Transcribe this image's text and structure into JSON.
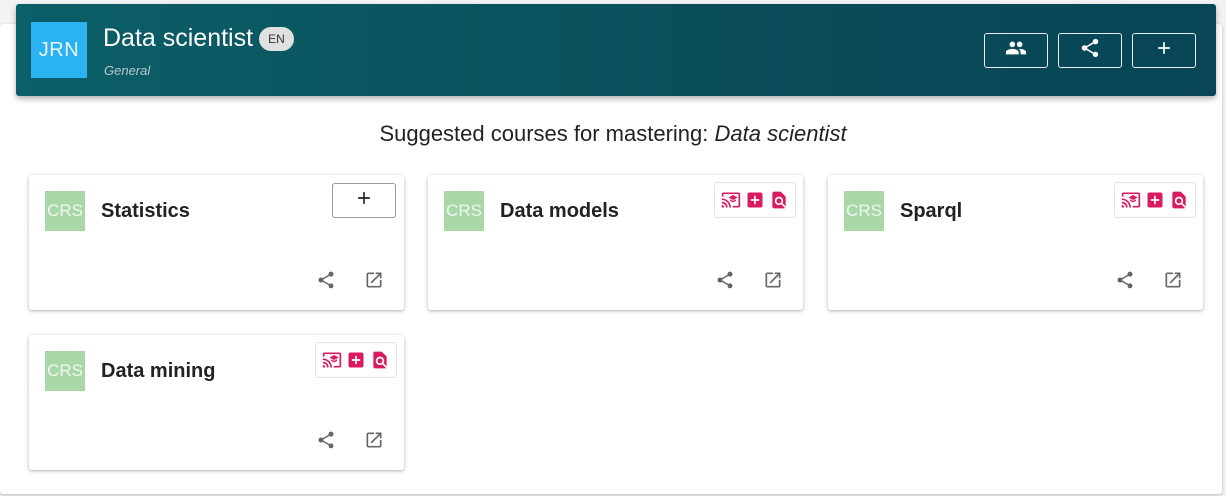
{
  "header": {
    "avatar_text": "JRN",
    "title": "Data scientist",
    "lang": "EN",
    "subtitle": "General",
    "buttons": [
      "group-icon",
      "share-icon",
      "plus-icon"
    ]
  },
  "section": {
    "prefix": "Suggested courses for mastering: ",
    "subject": "Data scientist"
  },
  "cards": [
    {
      "avatar": "CRS",
      "title": "Statistics",
      "tools": "add-button"
    },
    {
      "avatar": "CRS",
      "title": "Data models",
      "tools": "icon-group"
    },
    {
      "avatar": "CRS",
      "title": "Sparql",
      "tools": "icon-group"
    },
    {
      "avatar": "CRS",
      "title": "Data mining",
      "tools": "icon-group"
    }
  ],
  "colors": {
    "header_bg": "#0a4d59",
    "avatar_journey": "#2ab3f0",
    "avatar_course": "#a8d8a8",
    "action_icon": "#d81b60"
  }
}
